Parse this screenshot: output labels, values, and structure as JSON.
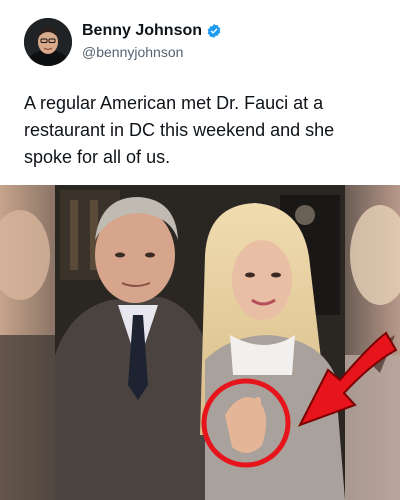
{
  "author": {
    "name": "Benny Johnson",
    "handle": "@bennyjohnson",
    "verified": true,
    "verified_color": "#1d9bf0"
  },
  "tweet": {
    "text": "A regular American met Dr. Fauci at a restaurant in DC this weekend and she spoke for all of us."
  },
  "media": {
    "highlight_color": "#e8141c"
  }
}
